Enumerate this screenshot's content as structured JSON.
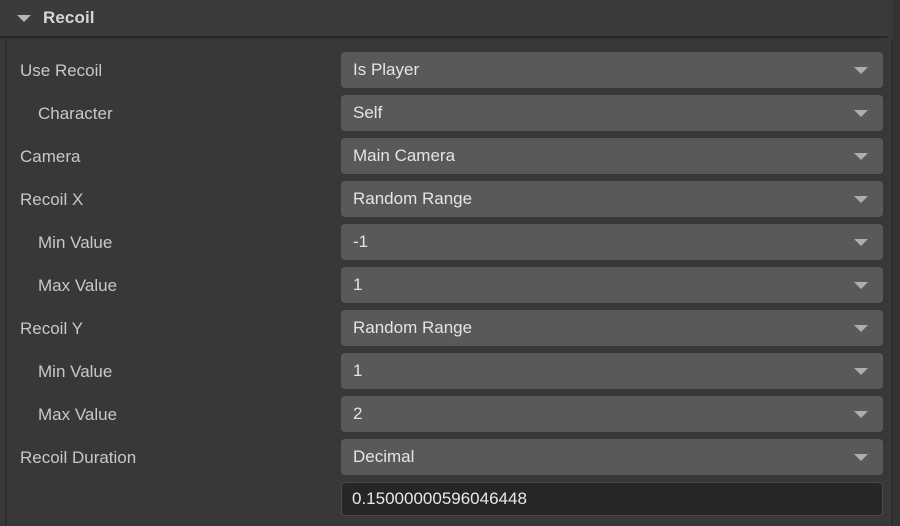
{
  "section": {
    "title": "Recoil",
    "expanded": true,
    "foldout_icon": "triangle-down-icon"
  },
  "colors": {
    "panel_background": "#383838",
    "header_background": "#3b3b3b",
    "dropdown_background": "#595959",
    "textfield_background": "#262626",
    "label_text": "#c8c8c8",
    "value_text": "#e4e4e4"
  },
  "rows": [
    {
      "label": "Use Recoil",
      "indent": 0,
      "control": "dropdown",
      "value": "Is Player",
      "caret_icon": "triangle-down-icon"
    },
    {
      "label": "Character",
      "indent": 1,
      "control": "dropdown",
      "value": "Self",
      "caret_icon": "triangle-down-icon"
    },
    {
      "label": "Camera",
      "indent": 0,
      "control": "dropdown",
      "value": "Main Camera",
      "caret_icon": "triangle-down-icon"
    },
    {
      "label": "Recoil X",
      "indent": 0,
      "control": "dropdown",
      "value": "Random Range",
      "caret_icon": "triangle-down-icon"
    },
    {
      "label": "Min Value",
      "indent": 1,
      "control": "dropdown",
      "value": "-1",
      "caret_icon": "triangle-down-icon"
    },
    {
      "label": "Max Value",
      "indent": 1,
      "control": "dropdown",
      "value": "1",
      "caret_icon": "triangle-down-icon"
    },
    {
      "label": "Recoil Y",
      "indent": 0,
      "control": "dropdown",
      "value": "Random Range",
      "caret_icon": "triangle-down-icon"
    },
    {
      "label": "Min Value",
      "indent": 1,
      "control": "dropdown",
      "value": "1",
      "caret_icon": "triangle-down-icon"
    },
    {
      "label": "Max Value",
      "indent": 1,
      "control": "dropdown",
      "value": "2",
      "caret_icon": "triangle-down-icon"
    },
    {
      "label": "Recoil Duration",
      "indent": 0,
      "control": "dropdown",
      "value": "Decimal",
      "caret_icon": "triangle-down-icon"
    },
    {
      "label": "",
      "indent": 0,
      "control": "textfield",
      "value": "0.15000000596046448",
      "placeholder": ""
    }
  ]
}
